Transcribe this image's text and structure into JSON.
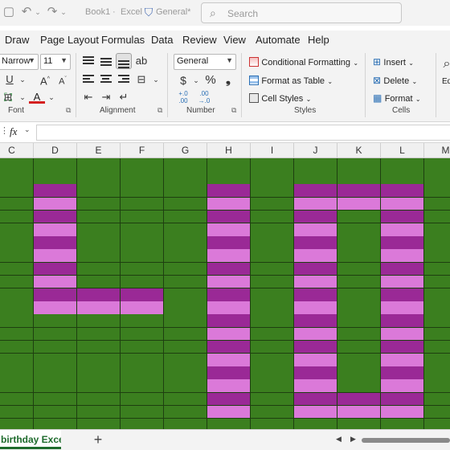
{
  "titlebar": {
    "doc_title": "Book1",
    "separator": "·",
    "app_name": "Excel",
    "sensitivity": "General*",
    "search_placeholder": "Search"
  },
  "menu_tabs": [
    "Draw",
    "Page Layout",
    "Formulas",
    "Data",
    "Review",
    "View",
    "Automate",
    "Help"
  ],
  "ribbon": {
    "font_name": "Narrow",
    "font_size": "11",
    "number_format": "General",
    "groups": {
      "font": "Font",
      "alignment": "Alignment",
      "number": "Number",
      "styles": "Styles",
      "cells": "Cells"
    },
    "styles": {
      "conditional_formatting": "Conditional Formatting",
      "format_as_table": "Format as Table",
      "cell_styles": "Cell Styles"
    },
    "cells": {
      "insert": "Insert",
      "delete": "Delete",
      "format": "Format"
    },
    "editing_partial": "Ed",
    "currency_symbol": "$",
    "percent_symbol": "%",
    "comma_symbol": "❟",
    "decimal_inc": "+.0\n.00",
    "decimal_dec": ".00\n→.0"
  },
  "formula_bar": {
    "fx_label": "fx",
    "value": ""
  },
  "columns": [
    "C",
    "D",
    "E",
    "F",
    "G",
    "H",
    "I",
    "J",
    "K",
    "L",
    "M"
  ],
  "colors": {
    "grid_green": "#3b7f1f",
    "purple_dark": "#9a2996",
    "pink_light": "#db79d9",
    "accent_green": "#1e6b2c"
  },
  "grid": {
    "rows": [
      "...........",
      "...........",
      ".P...P.PPP.",
      ".L...L.LLL.",
      ".P...P.P.P.",
      ".L...L.L.L.",
      ".P...P.P.P.",
      ".L...L.L.L.",
      ".P...P.P.P.",
      ".L...L.L.L.",
      ".PPP.P.P.P.",
      ".LLL.L.L.L.",
      ".....P.P.P.",
      ".....L.L.L.",
      ".....P.P.P.",
      ".....L.L.L.",
      ".....P.P.P.",
      ".....L.L.L.",
      ".....P.PPP.",
      ".....L.LLL.",
      "..........."
    ]
  },
  "sheet": {
    "tab_name": "birthday Excel",
    "add_label": "+"
  }
}
